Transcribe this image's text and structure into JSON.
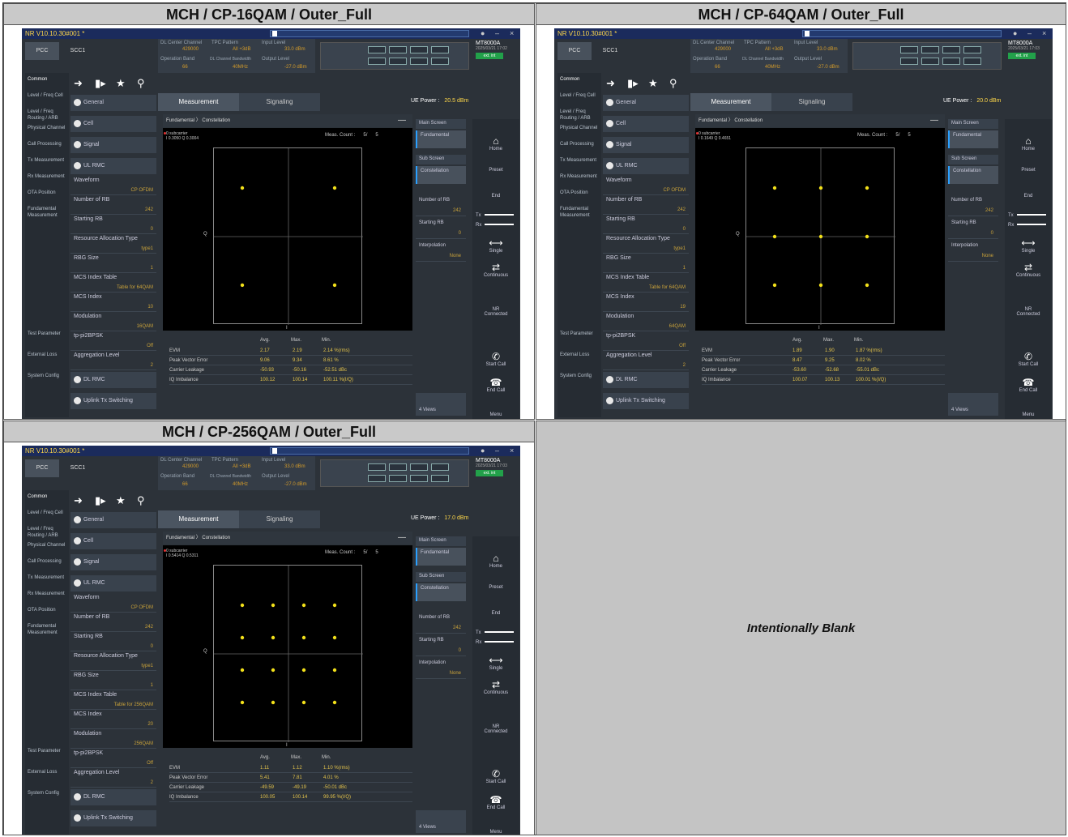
{
  "grid": {
    "cells": [
      {
        "title": "MCH / CP-16QAM / Outer_Full",
        "order": 4,
        "ue_power": "20.5 dBm",
        "subcarrier": "0 subcarrier",
        "iq_readout": "I 0.3050 Q 0.3004",
        "mcs_index": "10",
        "modulation": "16QAM",
        "mcs_table": "Table for 64QAM",
        "meas_count": "5/",
        "meas_total": "5",
        "timestamp": "2025/03/21 17:02",
        "stats": {
          "evm": [
            "2.17",
            "2.19",
            "2.14 %(rms)"
          ],
          "pve": [
            "9.06",
            "9.34",
            "8.61 %"
          ],
          "cl": [
            "-50.93",
            "-50.16",
            "-52.51 dBc"
          ],
          "iq": [
            "100.12",
            "100.14",
            "100.11 %(I/Q)"
          ]
        }
      },
      {
        "title": "MCH / CP-64QAM / Outer_Full",
        "order": 8,
        "ue_power": "20.0 dBm",
        "subcarrier": "0 subcarrier",
        "iq_readout": "I 0.1649 Q 0.4651",
        "mcs_index": "19",
        "modulation": "64QAM",
        "mcs_table": "Table for 64QAM",
        "meas_count": "5/",
        "meas_total": "5",
        "timestamp": "2025/03/21 17:03",
        "stats": {
          "evm": [
            "1.89",
            "1.90",
            "1.87 %(rms)"
          ],
          "pve": [
            "8.47",
            "9.25",
            "8.02 %"
          ],
          "cl": [
            "-53.60",
            "-52.68",
            "-55.01 dBc"
          ],
          "iq": [
            "100.07",
            "100.13",
            "100.01 %(I/Q)"
          ]
        }
      },
      {
        "title": "MCH / CP-256QAM / Outer_Full",
        "order": 16,
        "ue_power": "17.0 dBm",
        "subcarrier": "0 subcarrier",
        "iq_readout": "I 0.5414 Q 0.5311",
        "mcs_index": "20",
        "modulation": "256QAM",
        "mcs_table": "Table for 256QAM",
        "meas_count": "5/",
        "meas_total": "5",
        "timestamp": "2025/03/21 17:03",
        "stats": {
          "evm": [
            "1.11",
            "1.12",
            "1.10 %(rms)"
          ],
          "pve": [
            "5.41",
            "7.81",
            "4.01 %"
          ],
          "cl": [
            "-49.59",
            "-49.19",
            "-50.01 dBc"
          ],
          "iq": [
            "100.05",
            "100.14",
            "99.95 %(I/Q)"
          ]
        }
      }
    ],
    "blank_label": "Intentionally Blank"
  },
  "app": {
    "title": "NR V10.10.30#001 *",
    "brand": "MT8000A",
    "ext_badge": "ext. int",
    "tabs": [
      "PCC",
      "SCC1"
    ],
    "top_info": {
      "dl_center_channel_label": "DL Center Channel",
      "dl_center_channel": "429000",
      "tpc_pattern_label": "TPC Pattern",
      "tpc_pattern": "All +3dB",
      "input_level_label": "Input Level",
      "input_level": "33.0 dBm",
      "operation_band_label": "Operation Band",
      "operation_band": "66",
      "dl_bw_label": "DL Channel Bandwidth",
      "dl_bw": "40MHz",
      "output_level_label": "Output Level",
      "output_level": "-27.0 dBm"
    },
    "sidebar": [
      "Common",
      "Level / Freq Cell",
      "Level / Freq Routing / ARB",
      "Physical Channel",
      "Call Processing",
      "Tx Measurement",
      "Rx Measurement",
      "OTA Position",
      "Fundamental Measurement",
      "Test Parameter",
      "External Loss",
      "System Config"
    ],
    "menu": {
      "general": "General",
      "cell": "Cell",
      "signal": "Signal",
      "ul_rmc": "UL RMC",
      "waveform_label": "Waveform",
      "waveform": "CP OFDM",
      "rb_label": "Number of RB",
      "rb": "242",
      "start_rb_label": "Starting RB",
      "start_rb": "0",
      "alloc_label": "Resource Allocation Type",
      "alloc": "type1",
      "rbg_label": "RBG Size",
      "rbg": "1",
      "mcs_table_label": "MCS Index Table",
      "mcs_label": "MCS Index",
      "mod_label": "Modulation",
      "pi2_label": "tp-pi2BPSK",
      "pi2": "Off",
      "agg_label": "Aggregation Level",
      "agg": "2",
      "dl_rmc": "DL RMC",
      "uplink_tx": "Uplink Tx Switching"
    },
    "meas_tabs": [
      "Measurement",
      "Signaling"
    ],
    "ue_power_label": "UE Power :",
    "breadcrumb": [
      "Fundamental",
      "Constellation"
    ],
    "meas_count_label": "Meas. Count :",
    "q_label": "Q",
    "i_label": "I",
    "stats_headers": [
      "Avg.",
      "Max.",
      "Min."
    ],
    "stats_rows": [
      "EVM",
      "Peak Vector Error",
      "Carrier Leakage",
      "IQ Imbalance"
    ],
    "right_panel": {
      "main_screen": "Main Screen",
      "fundamental": "Fundamental",
      "sub_screen": "Sub Screen",
      "constellation": "Constellation",
      "rb_label": "Number of RB",
      "rb": "242",
      "start_rb_label": "Starting RB",
      "start_rb": "0",
      "interp_label": "Interpolation",
      "interp": "None",
      "views": "4 Views"
    },
    "right_bar": {
      "home": "Home",
      "preset": "Preset",
      "end": "End",
      "tx": "Tx",
      "rx": "Rx",
      "single": "Single",
      "continuous": "Continuous",
      "nr": "NR",
      "connected": "Connected",
      "start_call": "Start Call",
      "end_call": "End Call",
      "menu": "Menu"
    }
  },
  "colors": {
    "accent": "#2aa0ff",
    "dot": "#f2e01a",
    "connected": "#1b6fd6",
    "value": "#c9a23a"
  }
}
